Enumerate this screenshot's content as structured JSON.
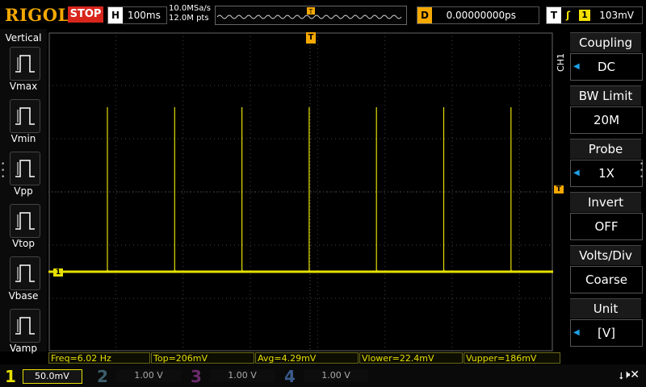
{
  "brand": "RIGOL",
  "run_state": "STOP",
  "horizontal": {
    "key": "H",
    "value": "100ms"
  },
  "sample": {
    "rate": "10.0MSa/s",
    "points": "12.0M pts"
  },
  "trigger_pos_marker": "T",
  "delay": {
    "key": "D",
    "value": "0.00000000ps"
  },
  "trigger": {
    "key": "T",
    "edge": "ʃ",
    "source": "1",
    "level": "103mV"
  },
  "left_menu": {
    "title": "Vertical",
    "items": [
      {
        "label": "Vmax",
        "icon": "vmax-icon"
      },
      {
        "label": "Vmin",
        "icon": "vmin-icon"
      },
      {
        "label": "Vpp",
        "icon": "vpp-icon"
      },
      {
        "label": "Vtop",
        "icon": "vtop-icon"
      },
      {
        "label": "Vbase",
        "icon": "vbase-icon"
      },
      {
        "label": "Vamp",
        "icon": "vamp-icon"
      }
    ]
  },
  "right_menu": {
    "channel": "CH1",
    "items": [
      {
        "title": "Coupling",
        "value": "DC",
        "arrow": true
      },
      {
        "title": "BW Limit",
        "value": "20M",
        "arrow": false
      },
      {
        "title": "Probe",
        "value": "1X",
        "arrow": true
      },
      {
        "title": "Invert",
        "value": "OFF",
        "arrow": false
      },
      {
        "title": "Volts/Div",
        "value": "Coarse",
        "arrow": false
      },
      {
        "title": "Unit",
        "value": "[V]",
        "arrow": true
      }
    ]
  },
  "measurements": [
    "Freq=6.02 Hz",
    "Top=206mV",
    "Avg=4.29mV",
    "Vlower=22.4mV",
    "Vupper=186mV"
  ],
  "channels": [
    {
      "num": "1",
      "scale": "50.0mV",
      "color": "#e6e000"
    },
    {
      "num": "2",
      "scale": "1.00 V",
      "color": "#1f6b66"
    },
    {
      "num": "3",
      "scale": "1.00 V",
      "color": "#6a2a6a"
    },
    {
      "num": "4",
      "scale": "1.00 V",
      "color": "#27406e"
    }
  ],
  "ch1_marker": "1",
  "trig_level_marker": "T",
  "colors": {
    "trace": "#e6e000",
    "trigger": "#f4a800",
    "stop": "#d8261d",
    "accent": "#1ea0e6"
  },
  "chart_data": {
    "type": "line",
    "series": [
      {
        "name": "1",
        "x_spikes_div": [
          0.6,
          1.6,
          2.6,
          3.6,
          4.6,
          5.6,
          6.6
        ],
        "baseline_mV": 0,
        "spike_peak_mV": 206
      }
    ],
    "x_divisions": 7.5,
    "y_divisions": 6,
    "grid": true
  }
}
